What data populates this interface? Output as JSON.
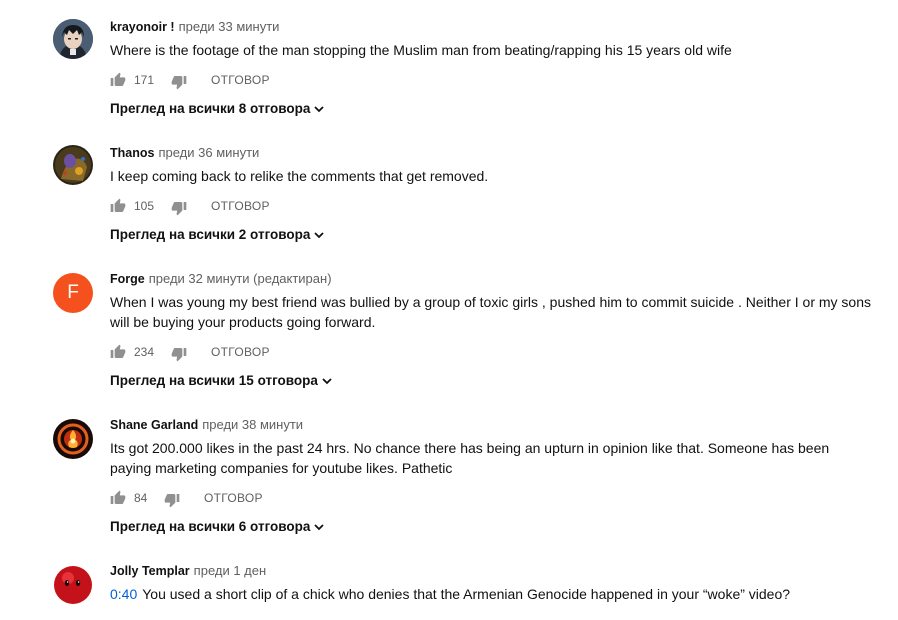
{
  "comments": [
    {
      "author": "krayonoir !",
      "time": "преди 33 минути",
      "text": "Where is the footage of the man stopping the Muslim man from beating/rapping his 15 years old wife",
      "likes": "171",
      "reply": "ОТГОВОР",
      "view_replies": "Преглед на всички 8 отговора",
      "avatar": "anime-character-avatar"
    },
    {
      "author": "Thanos",
      "time": "преди 36 минути",
      "text": "I keep coming back to relike the comments that get removed.",
      "likes": "105",
      "reply": "ОТГОВОР",
      "view_replies": "Преглед на всички 2 отговора",
      "avatar": "thanos-avatar"
    },
    {
      "author": "Forge",
      "time": "преди 32 минути (редактиран)",
      "text": "When I was young my best friend was bullied by a group of toxic girls , pushed him to commit suicide . Neither I or my sons will be buying your products going forward.",
      "likes": "234",
      "reply": "ОТГОВОР",
      "view_replies": "Преглед на всички 15 отговора",
      "avatar_letter": "F",
      "avatar_color": "#f4511e"
    },
    {
      "author": "Shane Garland",
      "time": "преди 38 минути",
      "text": "Its got 200.000 likes in the past 24 hrs. No chance there has being an upturn in opinion like that. Someone has been paying marketing companies for youtube likes. Pathetic",
      "likes": "84",
      "reply": "ОТГОВОР",
      "view_replies": "Преглед на всички 6 отговора",
      "avatar": "fire-emblem-avatar"
    },
    {
      "author": "Jolly Templar",
      "time": "преди 1 ден",
      "timestamp_link": "0:40",
      "text": "You used a short clip of a chick who denies that the Armenian Genocide happened in your “woke” video?",
      "avatar": "red-ball-avatar"
    }
  ],
  "colors": {
    "link": "#065fd4",
    "secondary_text": "#606060",
    "icon": "#909090"
  }
}
